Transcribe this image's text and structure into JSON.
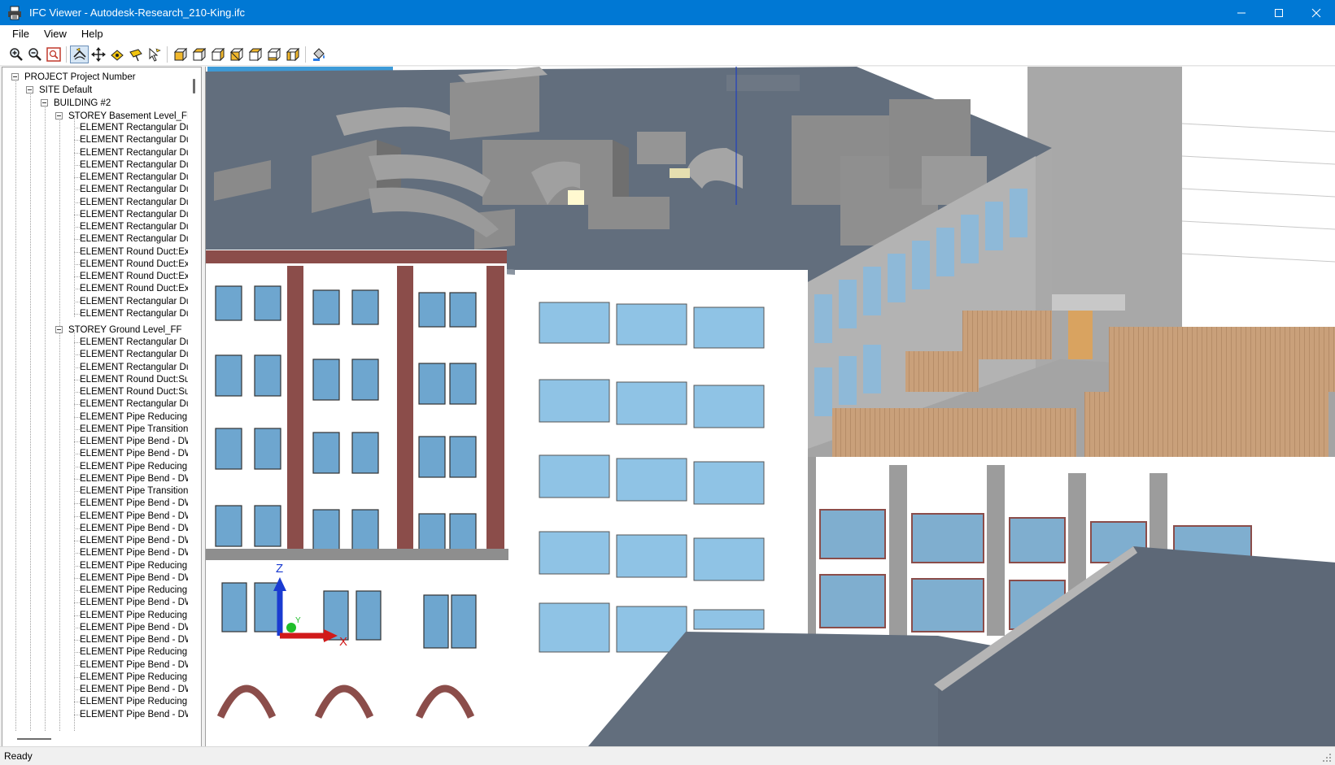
{
  "window": {
    "title": "IFC Viewer - Autodesk-Research_210-King.ifc",
    "icon": "printer-icon",
    "minimize_symbol": "—",
    "maximize_symbol": "☐",
    "close_symbol": "✕"
  },
  "menu": {
    "items": [
      "File",
      "View",
      "Help"
    ]
  },
  "toolbar": {
    "buttons": [
      {
        "icon": "zoom-in-icon",
        "tooltip": ""
      },
      {
        "icon": "zoom-out-icon",
        "tooltip": ""
      },
      {
        "icon": "zoom-extents-icon",
        "tooltip": ""
      },
      {
        "icon": "orbit-icon",
        "active": true
      },
      {
        "icon": "pan-icon"
      },
      {
        "icon": "walk-icon"
      },
      {
        "icon": "fly-icon"
      },
      {
        "icon": "select-icon"
      },
      {
        "icon": "view-front-icon"
      },
      {
        "icon": "view-back-icon"
      },
      {
        "icon": "view-left-icon"
      },
      {
        "icon": "view-right-icon"
      },
      {
        "icon": "view-top-icon"
      },
      {
        "icon": "view-bottom-icon"
      },
      {
        "icon": "view-iso-icon"
      },
      {
        "icon": "paint-bucket-icon"
      }
    ]
  },
  "tree": {
    "project": "PROJECT Project Number",
    "site": "SITE Default",
    "building": "BUILDING #2",
    "storey_basement": "STOREY Basement Level_FF",
    "basement_elements": [
      "ELEMENT Rectangular Du",
      "ELEMENT Rectangular Du",
      "ELEMENT Rectangular Du",
      "ELEMENT Rectangular Du",
      "ELEMENT Rectangular Du",
      "ELEMENT Rectangular Du",
      "ELEMENT Rectangular Du",
      "ELEMENT Rectangular Du",
      "ELEMENT Rectangular Du",
      "ELEMENT Rectangular Du",
      "ELEMENT Round Duct:Ex",
      "ELEMENT Round Duct:Ex",
      "ELEMENT Round Duct:Ex",
      "ELEMENT Round Duct:Ex",
      "ELEMENT Rectangular Du",
      "ELEMENT Rectangular Du"
    ],
    "storey_ground": "STOREY Ground Level_FF",
    "ground_elements": [
      "ELEMENT Rectangular Du",
      "ELEMENT Rectangular Du",
      "ELEMENT Rectangular Du",
      "ELEMENT Round Duct:Su",
      "ELEMENT Round Duct:Su",
      "ELEMENT Rectangular Du",
      "ELEMENT Pipe Reducing",
      "ELEMENT Pipe Transition:",
      "ELEMENT Pipe Bend - DW",
      "ELEMENT Pipe Bend - DW",
      "ELEMENT Pipe Reducing",
      "ELEMENT Pipe Bend - DW",
      "ELEMENT Pipe Transition:",
      "ELEMENT Pipe Bend - DW",
      "ELEMENT Pipe Bend - DW",
      "ELEMENT Pipe Bend - DW",
      "ELEMENT Pipe Bend - DW",
      "ELEMENT Pipe Bend - DW",
      "ELEMENT Pipe Reducing",
      "ELEMENT Pipe Bend - DW",
      "ELEMENT Pipe Reducing",
      "ELEMENT Pipe Bend - DW",
      "ELEMENT Pipe Reducing",
      "ELEMENT Pipe Bend - DW",
      "ELEMENT Pipe Bend - DW",
      "ELEMENT Pipe Reducing",
      "ELEMENT Pipe Bend - DW",
      "ELEMENT Pipe Reducing",
      "ELEMENT Pipe Bend - DW",
      "ELEMENT Pipe Reducing",
      "ELEMENT Pipe Bend - DW"
    ]
  },
  "viewport": {
    "axis_z": "Z",
    "axis_x": "X",
    "axis_y": "Y",
    "colors": {
      "roof": "#626e7d",
      "equipment": "#8c8c8c",
      "brick": "#8b4d4a",
      "glass": "#7fb6da",
      "wood": "#c9a07a",
      "concrete": "#9a9a9a"
    }
  },
  "status": {
    "text": "Ready"
  }
}
